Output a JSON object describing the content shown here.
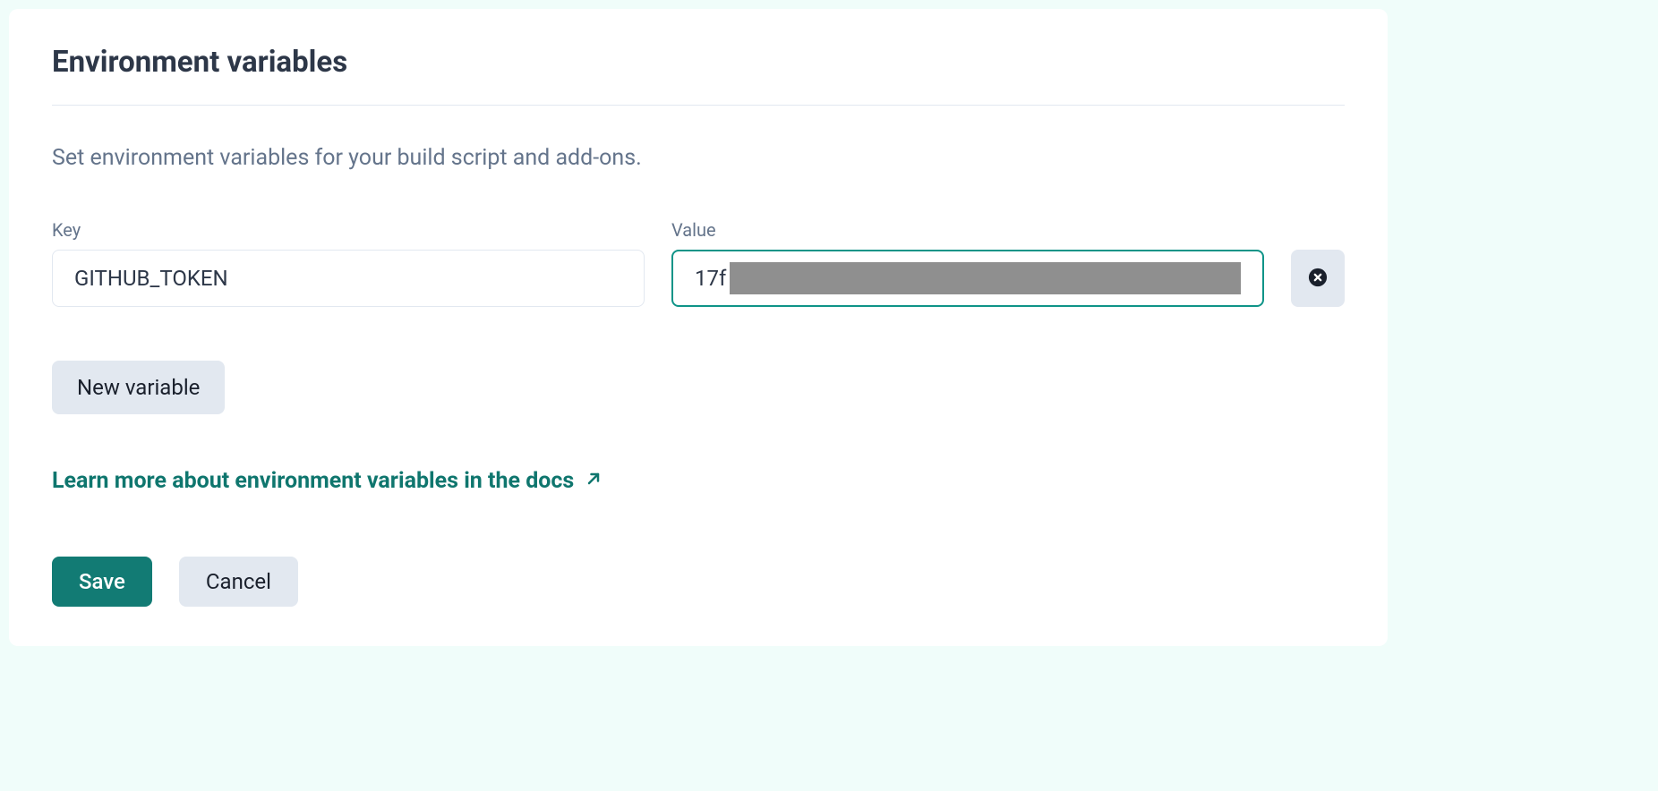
{
  "section": {
    "title": "Environment variables",
    "description": "Set environment variables for your build script and add-ons."
  },
  "fields": {
    "key_label": "Key",
    "value_label": "Value",
    "key_value": "GITHUB_TOKEN",
    "value_prefix": "17f"
  },
  "buttons": {
    "new_variable": "New variable",
    "save": "Save",
    "cancel": "Cancel"
  },
  "link": {
    "text": "Learn more about environment variables in the docs"
  }
}
